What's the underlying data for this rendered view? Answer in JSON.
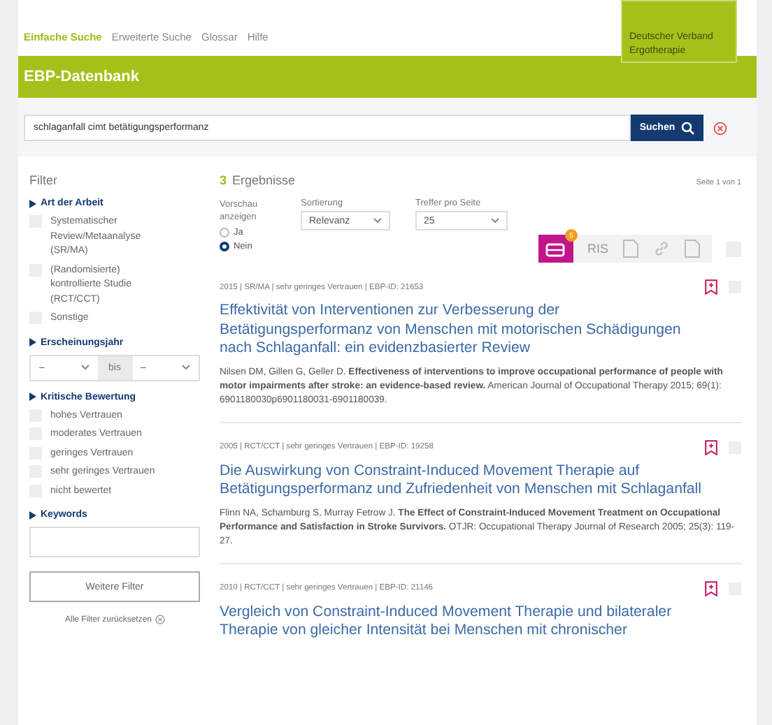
{
  "nav": [
    {
      "label": "Einfache Suche",
      "selected": true
    },
    {
      "label": "Erweiterte Suche",
      "selected": false
    },
    {
      "label": "Glossar",
      "selected": false
    },
    {
      "label": "Hilfe",
      "selected": false
    }
  ],
  "logo": {
    "lines": [
      "Deutscher Verband",
      "Ergotherapie"
    ]
  },
  "header": {
    "title": "EBP-Datenbank"
  },
  "search": {
    "value": "schlaganfall cimt betätigungsperformanz",
    "button": "Suchen"
  },
  "filter": {
    "title": "Filter",
    "groups": [
      {
        "kind": "checkboxes",
        "title": "Art der Arbeit",
        "options": [
          {
            "label": "Systematischer Review/Metaanalyse (SR/MA)",
            "checked": false
          },
          {
            "label": "(Randomisierte) kontrollierte Studie (RCT/CCT)",
            "checked": false
          },
          {
            "label": "Sonstige",
            "checked": false
          }
        ]
      },
      {
        "kind": "range",
        "title": "Erscheinungsjahr",
        "from": "–",
        "separator": "bis",
        "to": "–"
      },
      {
        "kind": "checkboxes",
        "title": "Kritische Bewertung",
        "options": [
          {
            "label": "hohes Vertrauen",
            "checked": false
          },
          {
            "label": "moderates Vertrauen",
            "checked": false
          },
          {
            "label": "geringes Vertrauen",
            "checked": false
          },
          {
            "label": "sehr geringes Vertrauen",
            "checked": false
          },
          {
            "label": "nicht bewertet",
            "checked": false
          }
        ]
      },
      {
        "kind": "text",
        "title": "Keywords"
      }
    ],
    "more_button": "Weitere Filter",
    "reset_link": "Alle Filter zurücksetzen"
  },
  "results": {
    "count": "3",
    "label": "Ergebnisse",
    "page": "Seite 1 von 1",
    "preview": {
      "label": "Vorschau anzeigen",
      "options": [
        {
          "label": "Ja",
          "selected": false
        },
        {
          "label": "Nein",
          "selected": true
        }
      ]
    },
    "sort": {
      "label": "Sortierung",
      "value": "Relevanz"
    },
    "per_page": {
      "label": "Treffer pro Seite",
      "value": "25"
    },
    "toolbar": {
      "badge": "5",
      "ris": "RIS",
      "select_all_checked": false
    },
    "items": [
      {
        "meta": "2015 | SR/MA | sehr geringes Vertrauen | EBP-ID: 21653",
        "title": "Effektivität von Interventionen zur Verbesserung der Betätigungsperformanz von Menschen mit motorischen Schädigungen nach Schlaganfall: ein evidenzbasierter Review",
        "citation": "Nilsen DM, Gillen G, Geller D. **Effectiveness of interventions to improve occupational performance of people with motor impairments after stroke: an evidence-based review.** American Journal of Occupational Therapy 2015; 69(1): 6901180030p6901180031-6901180039.",
        "checked": false
      },
      {
        "meta": "2005 | RCT/CCT | sehr geringes Vertrauen | EBP-ID: 19258",
        "title": "Die Auswirkung von Constraint-Induced Movement Therapie auf Betätigungsperformanz und Zufriedenheit von Menschen mit Schlaganfall",
        "citation": "Flinn NA, Schamburg S, Murray Fetrow J. **The Effect of Constraint-Induced Movement Treatment on Occupational Performance and Satisfaction in Stroke Survivors.** OTJR: Occupational Therapy Journal of Research 2005; 25(3): 119-27.",
        "checked": false
      },
      {
        "meta": "2010 | RCT/CCT | sehr geringes Vertrauen | EBP-ID: 21146",
        "title": "Vergleich von Constraint-Induced Movement Therapie und bilateraler Therapie von gleicher Intensität bei Menschen mit chronischer",
        "checked": false
      }
    ]
  }
}
